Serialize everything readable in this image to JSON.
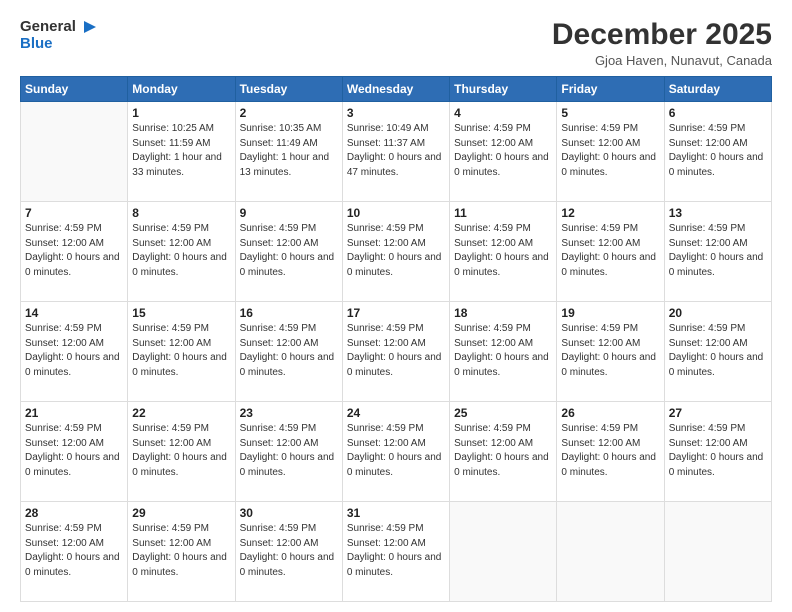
{
  "logo": {
    "line1": "General",
    "line2": "Blue"
  },
  "header": {
    "title": "December 2025",
    "subtitle": "Gjoa Haven, Nunavut, Canada"
  },
  "weekdays": [
    "Sunday",
    "Monday",
    "Tuesday",
    "Wednesday",
    "Thursday",
    "Friday",
    "Saturday"
  ],
  "weeks": [
    [
      {
        "day": "",
        "sunrise": "",
        "sunset": "",
        "daylight": ""
      },
      {
        "day": "1",
        "sunrise": "Sunrise: 10:25 AM",
        "sunset": "Sunset: 11:59 AM",
        "daylight": "Daylight: 1 hour and 33 minutes."
      },
      {
        "day": "2",
        "sunrise": "Sunrise: 10:35 AM",
        "sunset": "Sunset: 11:49 AM",
        "daylight": "Daylight: 1 hour and 13 minutes."
      },
      {
        "day": "3",
        "sunrise": "Sunrise: 10:49 AM",
        "sunset": "Sunset: 11:37 AM",
        "daylight": "Daylight: 0 hours and 47 minutes."
      },
      {
        "day": "4",
        "sunrise": "Sunrise: 4:59 PM",
        "sunset": "Sunset: 12:00 AM",
        "daylight": "Daylight: 0 hours and 0 minutes."
      },
      {
        "day": "5",
        "sunrise": "Sunrise: 4:59 PM",
        "sunset": "Sunset: 12:00 AM",
        "daylight": "Daylight: 0 hours and 0 minutes."
      },
      {
        "day": "6",
        "sunrise": "Sunrise: 4:59 PM",
        "sunset": "Sunset: 12:00 AM",
        "daylight": "Daylight: 0 hours and 0 minutes."
      }
    ],
    [
      {
        "day": "7",
        "sunrise": "Sunrise: 4:59 PM",
        "sunset": "Sunset: 12:00 AM",
        "daylight": "Daylight: 0 hours and 0 minutes."
      },
      {
        "day": "8",
        "sunrise": "Sunrise: 4:59 PM",
        "sunset": "Sunset: 12:00 AM",
        "daylight": "Daylight: 0 hours and 0 minutes."
      },
      {
        "day": "9",
        "sunrise": "Sunrise: 4:59 PM",
        "sunset": "Sunset: 12:00 AM",
        "daylight": "Daylight: 0 hours and 0 minutes."
      },
      {
        "day": "10",
        "sunrise": "Sunrise: 4:59 PM",
        "sunset": "Sunset: 12:00 AM",
        "daylight": "Daylight: 0 hours and 0 minutes."
      },
      {
        "day": "11",
        "sunrise": "Sunrise: 4:59 PM",
        "sunset": "Sunset: 12:00 AM",
        "daylight": "Daylight: 0 hours and 0 minutes."
      },
      {
        "day": "12",
        "sunrise": "Sunrise: 4:59 PM",
        "sunset": "Sunset: 12:00 AM",
        "daylight": "Daylight: 0 hours and 0 minutes."
      },
      {
        "day": "13",
        "sunrise": "Sunrise: 4:59 PM",
        "sunset": "Sunset: 12:00 AM",
        "daylight": "Daylight: 0 hours and 0 minutes."
      }
    ],
    [
      {
        "day": "14",
        "sunrise": "Sunrise: 4:59 PM",
        "sunset": "Sunset: 12:00 AM",
        "daylight": "Daylight: 0 hours and 0 minutes."
      },
      {
        "day": "15",
        "sunrise": "Sunrise: 4:59 PM",
        "sunset": "Sunset: 12:00 AM",
        "daylight": "Daylight: 0 hours and 0 minutes."
      },
      {
        "day": "16",
        "sunrise": "Sunrise: 4:59 PM",
        "sunset": "Sunset: 12:00 AM",
        "daylight": "Daylight: 0 hours and 0 minutes."
      },
      {
        "day": "17",
        "sunrise": "Sunrise: 4:59 PM",
        "sunset": "Sunset: 12:00 AM",
        "daylight": "Daylight: 0 hours and 0 minutes."
      },
      {
        "day": "18",
        "sunrise": "Sunrise: 4:59 PM",
        "sunset": "Sunset: 12:00 AM",
        "daylight": "Daylight: 0 hours and 0 minutes."
      },
      {
        "day": "19",
        "sunrise": "Sunrise: 4:59 PM",
        "sunset": "Sunset: 12:00 AM",
        "daylight": "Daylight: 0 hours and 0 minutes."
      },
      {
        "day": "20",
        "sunrise": "Sunrise: 4:59 PM",
        "sunset": "Sunset: 12:00 AM",
        "daylight": "Daylight: 0 hours and 0 minutes."
      }
    ],
    [
      {
        "day": "21",
        "sunrise": "Sunrise: 4:59 PM",
        "sunset": "Sunset: 12:00 AM",
        "daylight": "Daylight: 0 hours and 0 minutes."
      },
      {
        "day": "22",
        "sunrise": "Sunrise: 4:59 PM",
        "sunset": "Sunset: 12:00 AM",
        "daylight": "Daylight: 0 hours and 0 minutes."
      },
      {
        "day": "23",
        "sunrise": "Sunrise: 4:59 PM",
        "sunset": "Sunset: 12:00 AM",
        "daylight": "Daylight: 0 hours and 0 minutes."
      },
      {
        "day": "24",
        "sunrise": "Sunrise: 4:59 PM",
        "sunset": "Sunset: 12:00 AM",
        "daylight": "Daylight: 0 hours and 0 minutes."
      },
      {
        "day": "25",
        "sunrise": "Sunrise: 4:59 PM",
        "sunset": "Sunset: 12:00 AM",
        "daylight": "Daylight: 0 hours and 0 minutes."
      },
      {
        "day": "26",
        "sunrise": "Sunrise: 4:59 PM",
        "sunset": "Sunset: 12:00 AM",
        "daylight": "Daylight: 0 hours and 0 minutes."
      },
      {
        "day": "27",
        "sunrise": "Sunrise: 4:59 PM",
        "sunset": "Sunset: 12:00 AM",
        "daylight": "Daylight: 0 hours and 0 minutes."
      }
    ],
    [
      {
        "day": "28",
        "sunrise": "Sunrise: 4:59 PM",
        "sunset": "Sunset: 12:00 AM",
        "daylight": "Daylight: 0 hours and 0 minutes."
      },
      {
        "day": "29",
        "sunrise": "Sunrise: 4:59 PM",
        "sunset": "Sunset: 12:00 AM",
        "daylight": "Daylight: 0 hours and 0 minutes."
      },
      {
        "day": "30",
        "sunrise": "Sunrise: 4:59 PM",
        "sunset": "Sunset: 12:00 AM",
        "daylight": "Daylight: 0 hours and 0 minutes."
      },
      {
        "day": "31",
        "sunrise": "Sunrise: 4:59 PM",
        "sunset": "Sunset: 12:00 AM",
        "daylight": "Daylight: 0 hours and 0 minutes."
      },
      {
        "day": "",
        "sunrise": "",
        "sunset": "",
        "daylight": ""
      },
      {
        "day": "",
        "sunrise": "",
        "sunset": "",
        "daylight": ""
      },
      {
        "day": "",
        "sunrise": "",
        "sunset": "",
        "daylight": ""
      }
    ]
  ]
}
